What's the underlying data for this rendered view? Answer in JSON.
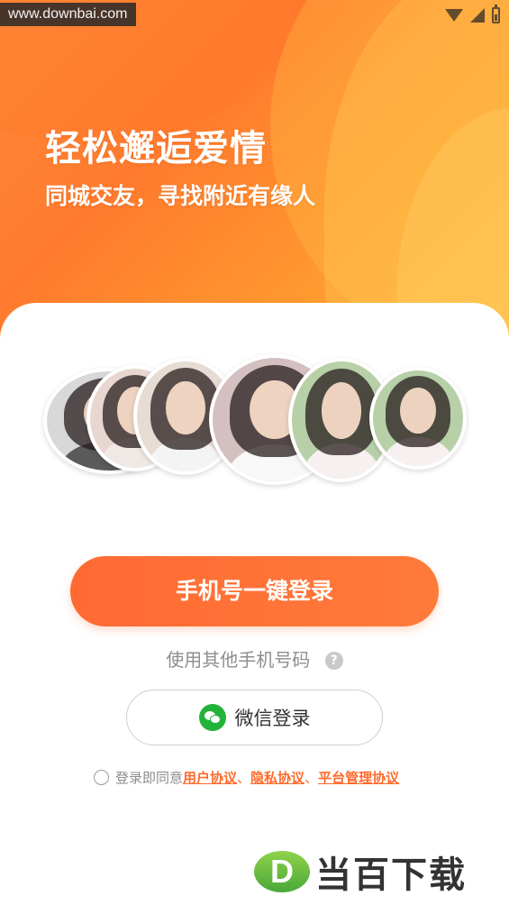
{
  "status_bar": {
    "watermark": "www.downbai.com",
    "icons": [
      "wifi-icon",
      "signal-icon",
      "battery-icon"
    ]
  },
  "hero": {
    "title": "轻松邂逅爱情",
    "subtitle": "同城交友，寻找附近有缘人"
  },
  "avatars": [
    {
      "name": "user-1",
      "tone": "#d8d8d8",
      "outfit": "#5a5a5a"
    },
    {
      "name": "user-2",
      "tone": "#e8d6d0",
      "outfit": "#f0e8e4"
    },
    {
      "name": "user-3",
      "tone": "#e6dcd4",
      "outfit": "#f4f4f4"
    },
    {
      "name": "user-4",
      "tone": "#d4c0c0",
      "outfit": "#f8f8f8"
    },
    {
      "name": "user-5",
      "tone": "#b8d0a8",
      "outfit": "#f6f0f0"
    }
  ],
  "actions": {
    "one_click_login": "手机号一键登录",
    "other_phone": "使用其他手机号码",
    "help_icon_glyph": "?",
    "wechat_login": "微信登录"
  },
  "agreement": {
    "prefix": "登录即同意",
    "user_agreement": "用户协议",
    "separator": "、",
    "privacy_agreement": "隐私协议",
    "platform_agreement": "平台管理协议"
  },
  "brand": {
    "logo_letter": "D",
    "name": "当百下载"
  },
  "colors": {
    "accent": "#ff6a33",
    "wechat": "#23b33b",
    "link": "#ff6a2a"
  }
}
